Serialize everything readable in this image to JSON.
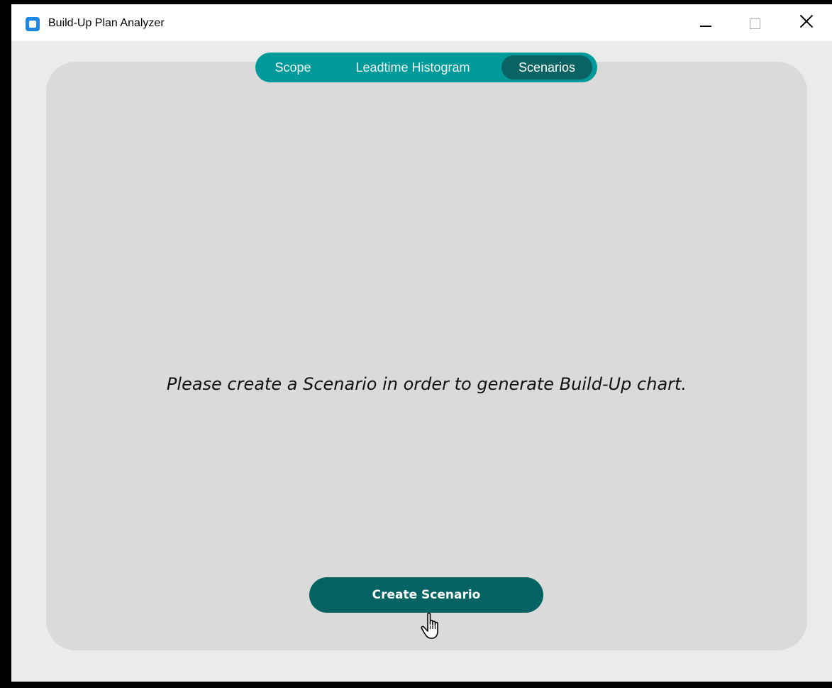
{
  "window": {
    "title": "Build-Up Plan Analyzer",
    "icons": {
      "app": "app-icon",
      "minimize": "minimize-icon",
      "maximize": "maximize-icon",
      "close": "close-icon"
    }
  },
  "tabs": [
    {
      "label": "Scope",
      "selected": false
    },
    {
      "label": "Leadtime Histogram",
      "selected": false
    },
    {
      "label": "Scenarios",
      "selected": true
    }
  ],
  "main": {
    "message": "Please create a Scenario in order to generate Build-Up chart.",
    "create_button_label": "Create Scenario"
  },
  "colors": {
    "window_bg": "#ebebeb",
    "panel_bg": "#dadada",
    "tab_bar": "#009a9a",
    "tab_selected": "#0b6262",
    "button": "#056463"
  },
  "cursor": "hand-pointer-icon"
}
